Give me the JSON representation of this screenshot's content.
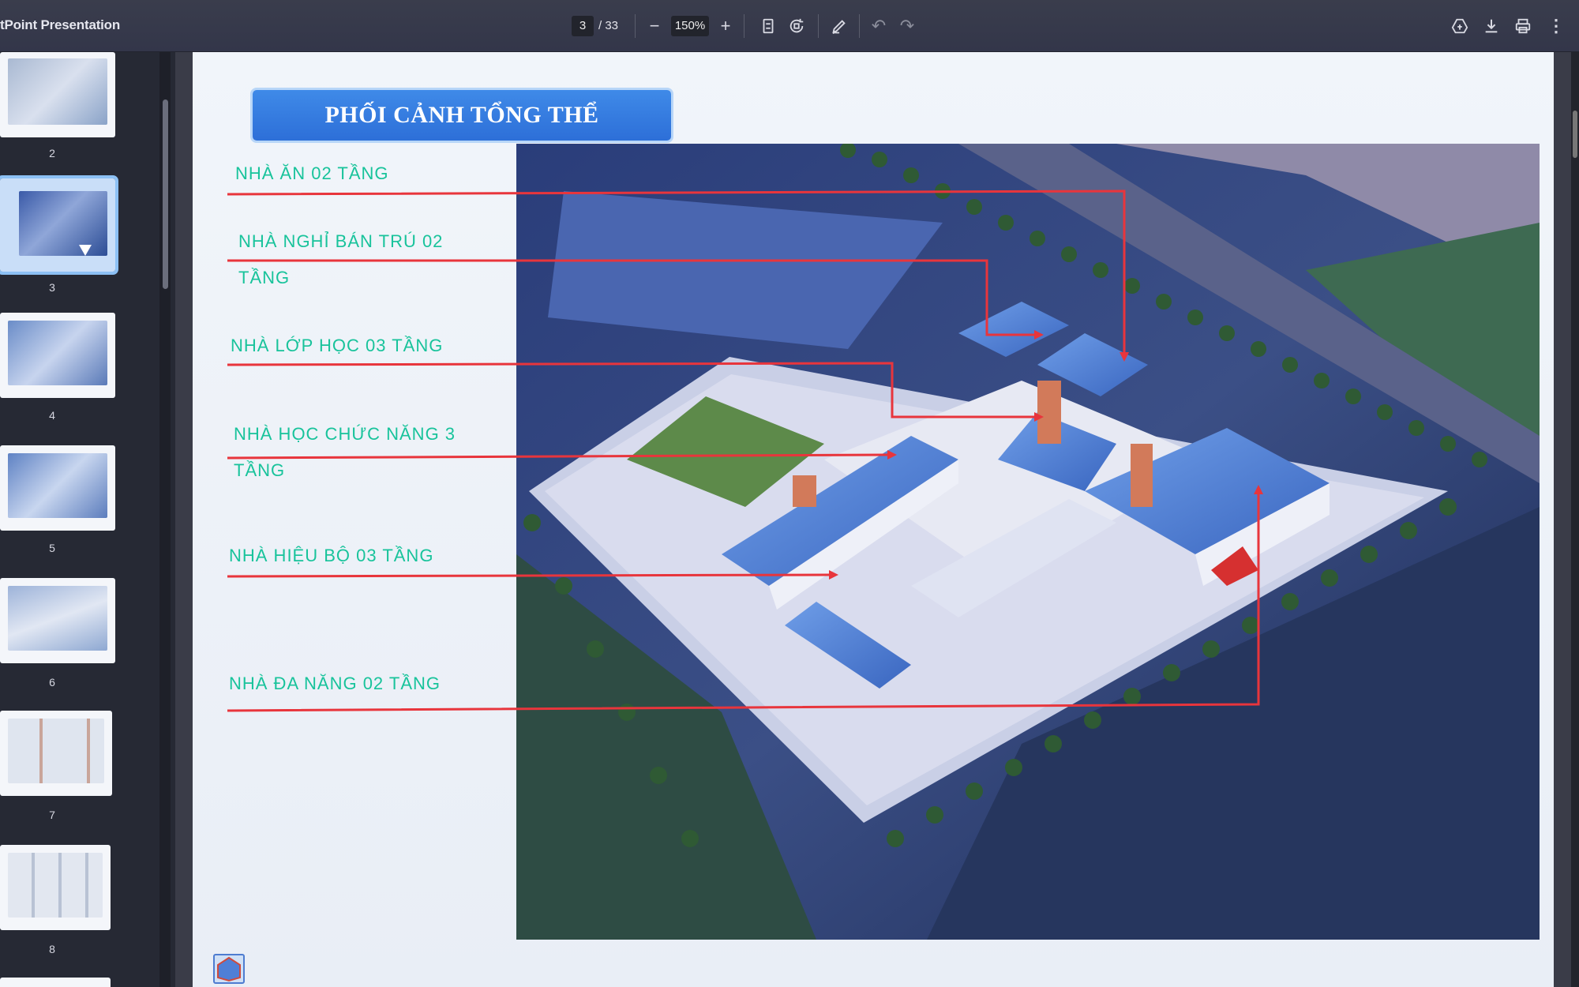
{
  "toolbar": {
    "doc_title": "tPoint Presentation",
    "page_current": "3",
    "page_total": "/ 33",
    "zoom": "150%",
    "icons": [
      "minus-icon",
      "plus-icon",
      "fit-page-icon",
      "rotate-icon",
      "annotate-icon",
      "undo-icon",
      "redo-icon",
      "drive-icon",
      "download-icon",
      "print-icon",
      "more-icon"
    ]
  },
  "sidebar": {
    "thumbnails": [
      {
        "number": "2",
        "active": false
      },
      {
        "number": "3",
        "active": true
      },
      {
        "number": "4",
        "active": false
      },
      {
        "number": "5",
        "active": false
      },
      {
        "number": "6",
        "active": false
      },
      {
        "number": "7",
        "active": false
      },
      {
        "number": "8",
        "active": false
      }
    ]
  },
  "slide": {
    "title": "PHỐI CẢNH TỔNG THỂ",
    "labels": {
      "nha_an": "NHÀ ĂN 02 TẦNG",
      "nha_nghi_1": "NHÀ NGHỈ BÁN TRÚ 02",
      "nha_nghi_2": "TẦNG",
      "nha_lop_hoc": "NHÀ LỚP HỌC 03 TẦNG",
      "nha_chuc_nang_1": "NHÀ HỌC CHỨC NĂNG 3",
      "nha_chuc_nang_2": "TẦNG",
      "nha_hieu_bo": "NHÀ HIỆU BỘ 03 TẦNG",
      "nha_da_nang": "NHÀ ĐA NĂNG 02 TẦNG"
    },
    "colors": {
      "label": "#18c39b",
      "leader": "#e8353c",
      "title_bg": "#2d6fd8"
    }
  }
}
